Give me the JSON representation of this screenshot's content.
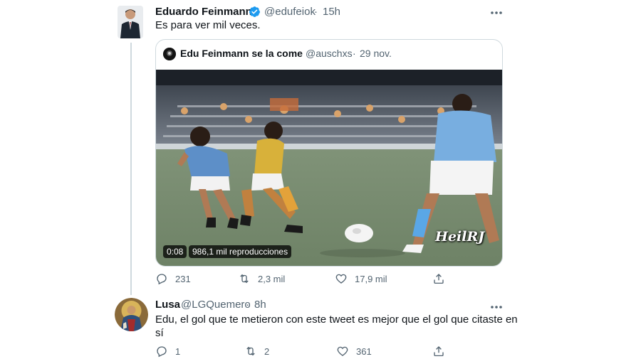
{
  "tweet": {
    "display_name": "Eduardo Feinmann",
    "handle": "@edufeiok",
    "separator": "·",
    "time": "15h",
    "text": "Es para ver mil veces.",
    "verified_icon": "verified-badge-icon",
    "avatar_icon": "man-in-suit-avatar"
  },
  "quote": {
    "display_name": "Edu Feinmann se la come",
    "handle": "@auschxs",
    "separator": "·",
    "date": "29 nov.",
    "video": {
      "duration": "0:08",
      "views": "986,1 mil reproducciones",
      "watermark": "HeilRJ"
    }
  },
  "tweet_actions": {
    "replies": "231",
    "retweets": "2,3 mil",
    "likes": "17,9 mil"
  },
  "reply": {
    "display_name": "Lusa",
    "handle": "@LGQuemero",
    "separator": "·",
    "time": "8h",
    "text_line1": "Edu, el gol que te metieron con este tweet es mejor que el gol que citaste en",
    "text_line2": "sí",
    "avatar_icon": "saint-figure-avatar"
  },
  "reply_actions": {
    "replies": "1",
    "retweets": "2",
    "likes": "361"
  },
  "icons": [
    "reply-icon",
    "retweet-icon",
    "like-icon",
    "share-icon",
    "more-options-icon"
  ]
}
